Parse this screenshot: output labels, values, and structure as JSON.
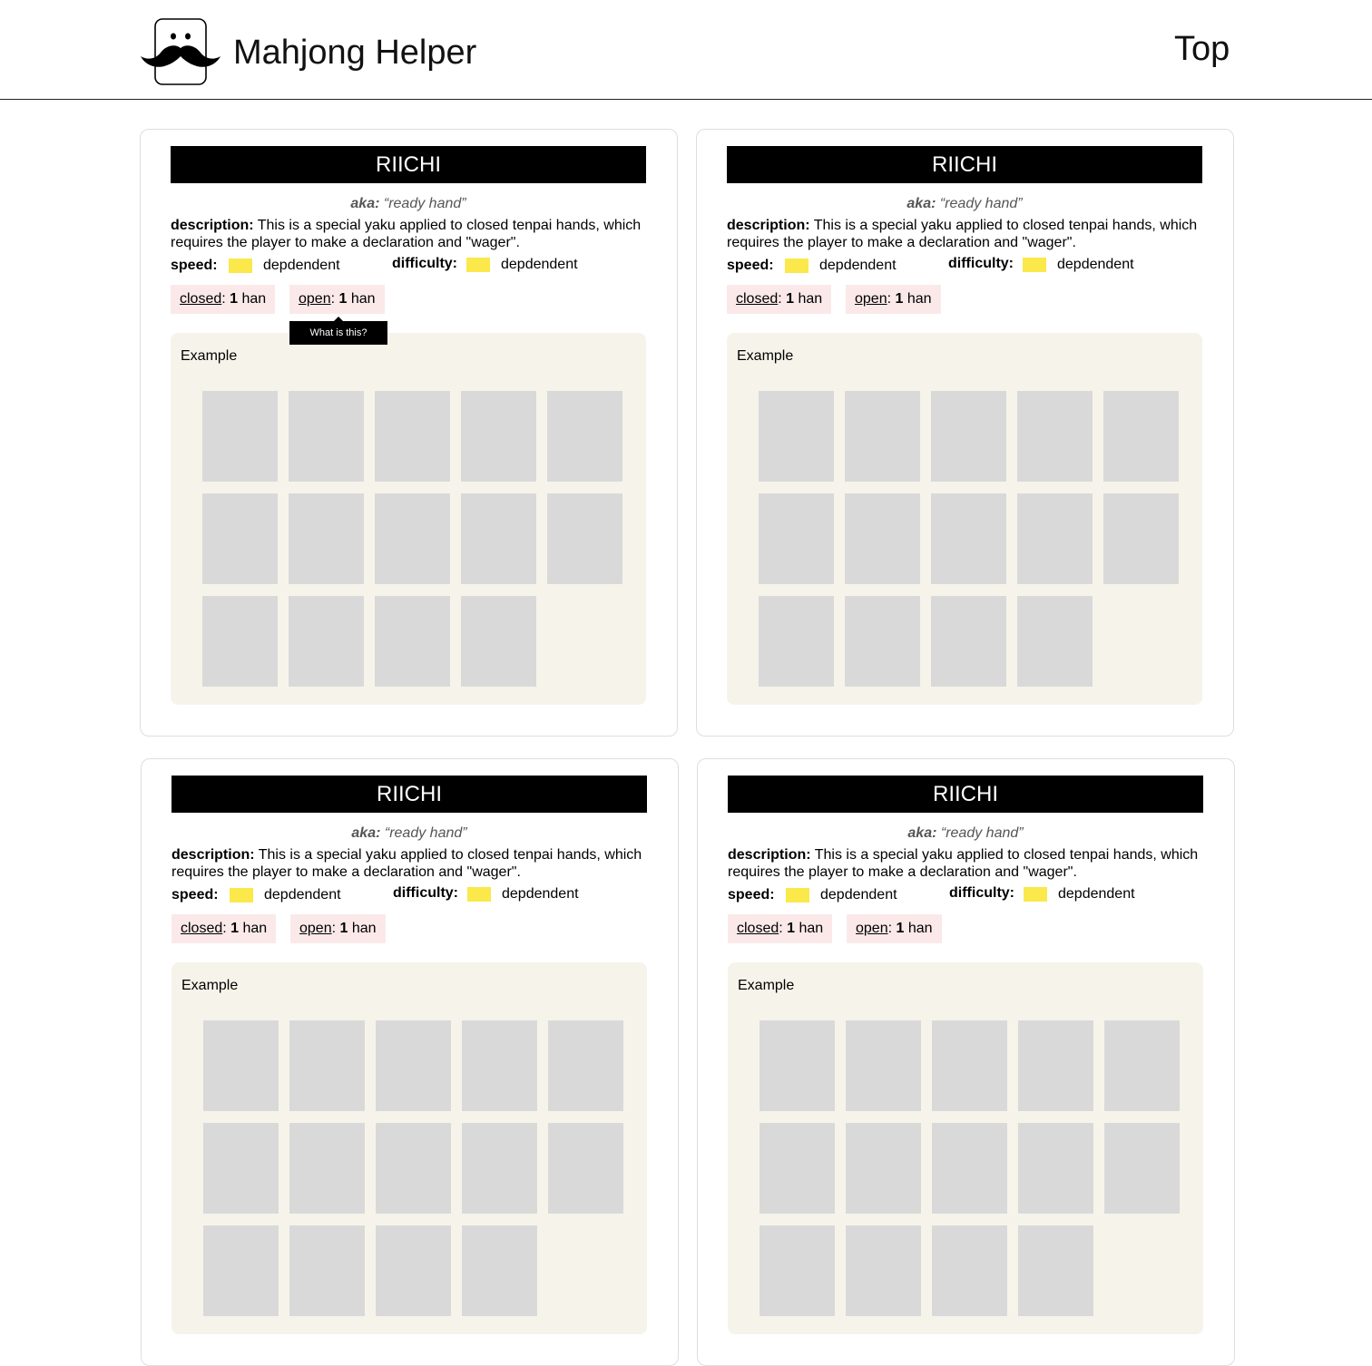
{
  "header": {
    "app_title": "Mahjong Helper",
    "top_link": "Top"
  },
  "labels": {
    "aka": "aka:",
    "description": "description:",
    "speed": "speed:",
    "difficulty": "difficulty:",
    "closed": "closed",
    "open": "open",
    "han": "han",
    "example": "Example"
  },
  "tooltip": "What is this?",
  "colors": {
    "speed_swatch": "#fbe84a",
    "difficulty_swatch": "#fbe84a",
    "chip_bg": "#fbe9e9",
    "example_bg": "#f6f4ea",
    "tile": "#d9d9d9"
  },
  "cards": [
    {
      "title": "RIICHI",
      "aka": "“ready hand”",
      "description": "This is a special yaku applied to closed tenpai hands, which requires the player to make a declaration and \"wager\".",
      "speed": "depdendent",
      "difficulty": "depdendent",
      "closed_han": "1",
      "open_han": "1",
      "example_tiles": 14
    },
    {
      "title": "RIICHI",
      "aka": "“ready hand”",
      "description": "This is a special yaku applied to closed tenpai hands, which requires the player to make a declaration and \"wager\".",
      "speed": "depdendent",
      "difficulty": "depdendent",
      "closed_han": "1",
      "open_han": "1",
      "example_tiles": 14
    },
    {
      "title": "RIICHI",
      "aka": "“ready hand”",
      "description": "This is a special yaku applied to closed tenpai hands, which requires the player to make a declaration and \"wager\".",
      "speed": "depdendent",
      "difficulty": "depdendent",
      "closed_han": "1",
      "open_han": "1",
      "example_tiles": 14
    },
    {
      "title": "RIICHI",
      "aka": "“ready hand”",
      "description": "This is a special yaku applied to closed tenpai hands, which requires the player to make a declaration and \"wager\".",
      "speed": "depdendent",
      "difficulty": "depdendent",
      "closed_han": "1",
      "open_han": "1",
      "example_tiles": 14
    }
  ]
}
